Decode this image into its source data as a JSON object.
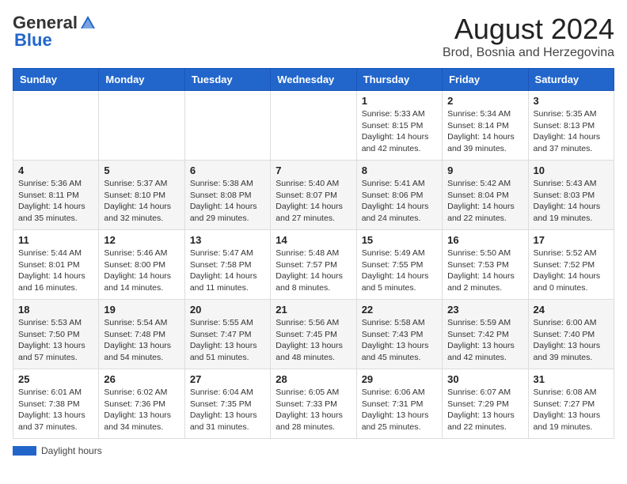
{
  "header": {
    "logo_general": "General",
    "logo_blue": "Blue",
    "month_title": "August 2024",
    "location": "Brod, Bosnia and Herzegovina"
  },
  "days_of_week": [
    "Sunday",
    "Monday",
    "Tuesday",
    "Wednesday",
    "Thursday",
    "Friday",
    "Saturday"
  ],
  "weeks": [
    [
      {
        "day": "",
        "info": ""
      },
      {
        "day": "",
        "info": ""
      },
      {
        "day": "",
        "info": ""
      },
      {
        "day": "",
        "info": ""
      },
      {
        "day": "1",
        "info": "Sunrise: 5:33 AM\nSunset: 8:15 PM\nDaylight: 14 hours\nand 42 minutes."
      },
      {
        "day": "2",
        "info": "Sunrise: 5:34 AM\nSunset: 8:14 PM\nDaylight: 14 hours\nand 39 minutes."
      },
      {
        "day": "3",
        "info": "Sunrise: 5:35 AM\nSunset: 8:13 PM\nDaylight: 14 hours\nand 37 minutes."
      }
    ],
    [
      {
        "day": "4",
        "info": "Sunrise: 5:36 AM\nSunset: 8:11 PM\nDaylight: 14 hours\nand 35 minutes."
      },
      {
        "day": "5",
        "info": "Sunrise: 5:37 AM\nSunset: 8:10 PM\nDaylight: 14 hours\nand 32 minutes."
      },
      {
        "day": "6",
        "info": "Sunrise: 5:38 AM\nSunset: 8:08 PM\nDaylight: 14 hours\nand 29 minutes."
      },
      {
        "day": "7",
        "info": "Sunrise: 5:40 AM\nSunset: 8:07 PM\nDaylight: 14 hours\nand 27 minutes."
      },
      {
        "day": "8",
        "info": "Sunrise: 5:41 AM\nSunset: 8:06 PM\nDaylight: 14 hours\nand 24 minutes."
      },
      {
        "day": "9",
        "info": "Sunrise: 5:42 AM\nSunset: 8:04 PM\nDaylight: 14 hours\nand 22 minutes."
      },
      {
        "day": "10",
        "info": "Sunrise: 5:43 AM\nSunset: 8:03 PM\nDaylight: 14 hours\nand 19 minutes."
      }
    ],
    [
      {
        "day": "11",
        "info": "Sunrise: 5:44 AM\nSunset: 8:01 PM\nDaylight: 14 hours\nand 16 minutes."
      },
      {
        "day": "12",
        "info": "Sunrise: 5:46 AM\nSunset: 8:00 PM\nDaylight: 14 hours\nand 14 minutes."
      },
      {
        "day": "13",
        "info": "Sunrise: 5:47 AM\nSunset: 7:58 PM\nDaylight: 14 hours\nand 11 minutes."
      },
      {
        "day": "14",
        "info": "Sunrise: 5:48 AM\nSunset: 7:57 PM\nDaylight: 14 hours\nand 8 minutes."
      },
      {
        "day": "15",
        "info": "Sunrise: 5:49 AM\nSunset: 7:55 PM\nDaylight: 14 hours\nand 5 minutes."
      },
      {
        "day": "16",
        "info": "Sunrise: 5:50 AM\nSunset: 7:53 PM\nDaylight: 14 hours\nand 2 minutes."
      },
      {
        "day": "17",
        "info": "Sunrise: 5:52 AM\nSunset: 7:52 PM\nDaylight: 14 hours\nand 0 minutes."
      }
    ],
    [
      {
        "day": "18",
        "info": "Sunrise: 5:53 AM\nSunset: 7:50 PM\nDaylight: 13 hours\nand 57 minutes."
      },
      {
        "day": "19",
        "info": "Sunrise: 5:54 AM\nSunset: 7:48 PM\nDaylight: 13 hours\nand 54 minutes."
      },
      {
        "day": "20",
        "info": "Sunrise: 5:55 AM\nSunset: 7:47 PM\nDaylight: 13 hours\nand 51 minutes."
      },
      {
        "day": "21",
        "info": "Sunrise: 5:56 AM\nSunset: 7:45 PM\nDaylight: 13 hours\nand 48 minutes."
      },
      {
        "day": "22",
        "info": "Sunrise: 5:58 AM\nSunset: 7:43 PM\nDaylight: 13 hours\nand 45 minutes."
      },
      {
        "day": "23",
        "info": "Sunrise: 5:59 AM\nSunset: 7:42 PM\nDaylight: 13 hours\nand 42 minutes."
      },
      {
        "day": "24",
        "info": "Sunrise: 6:00 AM\nSunset: 7:40 PM\nDaylight: 13 hours\nand 39 minutes."
      }
    ],
    [
      {
        "day": "25",
        "info": "Sunrise: 6:01 AM\nSunset: 7:38 PM\nDaylight: 13 hours\nand 37 minutes."
      },
      {
        "day": "26",
        "info": "Sunrise: 6:02 AM\nSunset: 7:36 PM\nDaylight: 13 hours\nand 34 minutes."
      },
      {
        "day": "27",
        "info": "Sunrise: 6:04 AM\nSunset: 7:35 PM\nDaylight: 13 hours\nand 31 minutes."
      },
      {
        "day": "28",
        "info": "Sunrise: 6:05 AM\nSunset: 7:33 PM\nDaylight: 13 hours\nand 28 minutes."
      },
      {
        "day": "29",
        "info": "Sunrise: 6:06 AM\nSunset: 7:31 PM\nDaylight: 13 hours\nand 25 minutes."
      },
      {
        "day": "30",
        "info": "Sunrise: 6:07 AM\nSunset: 7:29 PM\nDaylight: 13 hours\nand 22 minutes."
      },
      {
        "day": "31",
        "info": "Sunrise: 6:08 AM\nSunset: 7:27 PM\nDaylight: 13 hours\nand 19 minutes."
      }
    ]
  ],
  "footer": {
    "daylight_label": "Daylight hours"
  }
}
